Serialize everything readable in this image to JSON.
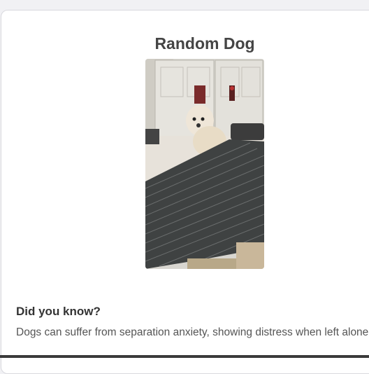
{
  "page": {
    "title": "Random Dog",
    "image_alt": "",
    "fact": {
      "heading": "Did you know?",
      "text": "Dogs can suffer from separation anxiety, showing distress when left alone."
    }
  },
  "colors": {
    "background": "#f1f1f4",
    "card": "#ffffff",
    "title": "#444444",
    "heading": "#333333",
    "body_text": "#555555"
  }
}
